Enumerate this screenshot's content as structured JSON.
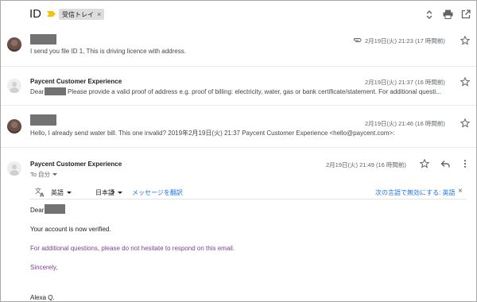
{
  "thread": {
    "subject": "ID",
    "label": "受信トレイ",
    "label_close": "×"
  },
  "messages": [
    {
      "snippet": "I send you file ID 1, This is driving licence with address.",
      "time": "2月19日(火) 21:23 (17 時間前)"
    },
    {
      "sender": "Paycent Customer Experience",
      "snippet_prefix": "Dear",
      "snippet": "Please provide a valid proof of address e.g. proof of billing: electricity, water, gas or bank certificate/statement. For additional questi...",
      "time": "2月19日(火) 21:37 (16 時間前)"
    },
    {
      "snippet": "Hello, I already send water bill. This one invalid? 2019年2月19日(火) 21:37 Paycent Customer Experience <hello@paycent.com>:",
      "time": "2月19日(火) 21:46 (16 時間前)"
    },
    {
      "sender": "Paycent Customer Experience",
      "to_label": "To 自分",
      "time": "2月19日(火) 21:49 (16 時間前)"
    }
  ],
  "translate_bar": {
    "source_lang": "英語",
    "target_lang": "日本語",
    "translate_link": "メッセージを翻訳",
    "disable_link": "次の言語で無効にする: 英語",
    "close": "×"
  },
  "open_message": {
    "greeting": "Dear",
    "verified": "Your account is now verified.",
    "questions": "For additional questions, please do not hesitate to respond on this email.",
    "closing": "Sincerely,",
    "signature": "Alexa Q."
  },
  "colors": {
    "important_marker": "#f4c20d",
    "link_blue": "#1a73e8",
    "purple_text": "#7e3e96",
    "redaction": "#727272"
  },
  "icons": {
    "expand": "expand-all-icon",
    "print": "print-icon",
    "popout": "open-in-new-window-icon",
    "attachment": "paperclip-icon",
    "star": "star-outline-icon",
    "reply": "reply-icon",
    "more": "more-vert-icon",
    "translate": "translate-icon"
  }
}
